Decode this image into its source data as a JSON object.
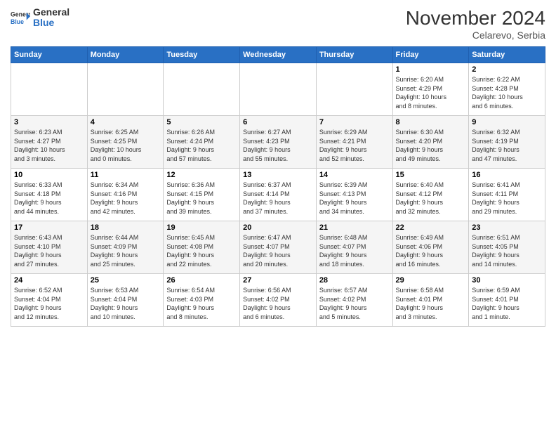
{
  "header": {
    "logo_general": "General",
    "logo_blue": "Blue",
    "month_title": "November 2024",
    "location": "Celarevo, Serbia"
  },
  "days_of_week": [
    "Sunday",
    "Monday",
    "Tuesday",
    "Wednesday",
    "Thursday",
    "Friday",
    "Saturday"
  ],
  "weeks": [
    {
      "days": [
        {
          "num": "",
          "info": ""
        },
        {
          "num": "",
          "info": ""
        },
        {
          "num": "",
          "info": ""
        },
        {
          "num": "",
          "info": ""
        },
        {
          "num": "",
          "info": ""
        },
        {
          "num": "1",
          "info": "Sunrise: 6:20 AM\nSunset: 4:29 PM\nDaylight: 10 hours\nand 8 minutes."
        },
        {
          "num": "2",
          "info": "Sunrise: 6:22 AM\nSunset: 4:28 PM\nDaylight: 10 hours\nand 6 minutes."
        }
      ]
    },
    {
      "days": [
        {
          "num": "3",
          "info": "Sunrise: 6:23 AM\nSunset: 4:27 PM\nDaylight: 10 hours\nand 3 minutes."
        },
        {
          "num": "4",
          "info": "Sunrise: 6:25 AM\nSunset: 4:25 PM\nDaylight: 10 hours\nand 0 minutes."
        },
        {
          "num": "5",
          "info": "Sunrise: 6:26 AM\nSunset: 4:24 PM\nDaylight: 9 hours\nand 57 minutes."
        },
        {
          "num": "6",
          "info": "Sunrise: 6:27 AM\nSunset: 4:23 PM\nDaylight: 9 hours\nand 55 minutes."
        },
        {
          "num": "7",
          "info": "Sunrise: 6:29 AM\nSunset: 4:21 PM\nDaylight: 9 hours\nand 52 minutes."
        },
        {
          "num": "8",
          "info": "Sunrise: 6:30 AM\nSunset: 4:20 PM\nDaylight: 9 hours\nand 49 minutes."
        },
        {
          "num": "9",
          "info": "Sunrise: 6:32 AM\nSunset: 4:19 PM\nDaylight: 9 hours\nand 47 minutes."
        }
      ]
    },
    {
      "days": [
        {
          "num": "10",
          "info": "Sunrise: 6:33 AM\nSunset: 4:18 PM\nDaylight: 9 hours\nand 44 minutes."
        },
        {
          "num": "11",
          "info": "Sunrise: 6:34 AM\nSunset: 4:16 PM\nDaylight: 9 hours\nand 42 minutes."
        },
        {
          "num": "12",
          "info": "Sunrise: 6:36 AM\nSunset: 4:15 PM\nDaylight: 9 hours\nand 39 minutes."
        },
        {
          "num": "13",
          "info": "Sunrise: 6:37 AM\nSunset: 4:14 PM\nDaylight: 9 hours\nand 37 minutes."
        },
        {
          "num": "14",
          "info": "Sunrise: 6:39 AM\nSunset: 4:13 PM\nDaylight: 9 hours\nand 34 minutes."
        },
        {
          "num": "15",
          "info": "Sunrise: 6:40 AM\nSunset: 4:12 PM\nDaylight: 9 hours\nand 32 minutes."
        },
        {
          "num": "16",
          "info": "Sunrise: 6:41 AM\nSunset: 4:11 PM\nDaylight: 9 hours\nand 29 minutes."
        }
      ]
    },
    {
      "days": [
        {
          "num": "17",
          "info": "Sunrise: 6:43 AM\nSunset: 4:10 PM\nDaylight: 9 hours\nand 27 minutes."
        },
        {
          "num": "18",
          "info": "Sunrise: 6:44 AM\nSunset: 4:09 PM\nDaylight: 9 hours\nand 25 minutes."
        },
        {
          "num": "19",
          "info": "Sunrise: 6:45 AM\nSunset: 4:08 PM\nDaylight: 9 hours\nand 22 minutes."
        },
        {
          "num": "20",
          "info": "Sunrise: 6:47 AM\nSunset: 4:07 PM\nDaylight: 9 hours\nand 20 minutes."
        },
        {
          "num": "21",
          "info": "Sunrise: 6:48 AM\nSunset: 4:07 PM\nDaylight: 9 hours\nand 18 minutes."
        },
        {
          "num": "22",
          "info": "Sunrise: 6:49 AM\nSunset: 4:06 PM\nDaylight: 9 hours\nand 16 minutes."
        },
        {
          "num": "23",
          "info": "Sunrise: 6:51 AM\nSunset: 4:05 PM\nDaylight: 9 hours\nand 14 minutes."
        }
      ]
    },
    {
      "days": [
        {
          "num": "24",
          "info": "Sunrise: 6:52 AM\nSunset: 4:04 PM\nDaylight: 9 hours\nand 12 minutes."
        },
        {
          "num": "25",
          "info": "Sunrise: 6:53 AM\nSunset: 4:04 PM\nDaylight: 9 hours\nand 10 minutes."
        },
        {
          "num": "26",
          "info": "Sunrise: 6:54 AM\nSunset: 4:03 PM\nDaylight: 9 hours\nand 8 minutes."
        },
        {
          "num": "27",
          "info": "Sunrise: 6:56 AM\nSunset: 4:02 PM\nDaylight: 9 hours\nand 6 minutes."
        },
        {
          "num": "28",
          "info": "Sunrise: 6:57 AM\nSunset: 4:02 PM\nDaylight: 9 hours\nand 5 minutes."
        },
        {
          "num": "29",
          "info": "Sunrise: 6:58 AM\nSunset: 4:01 PM\nDaylight: 9 hours\nand 3 minutes."
        },
        {
          "num": "30",
          "info": "Sunrise: 6:59 AM\nSunset: 4:01 PM\nDaylight: 9 hours\nand 1 minute."
        }
      ]
    }
  ]
}
